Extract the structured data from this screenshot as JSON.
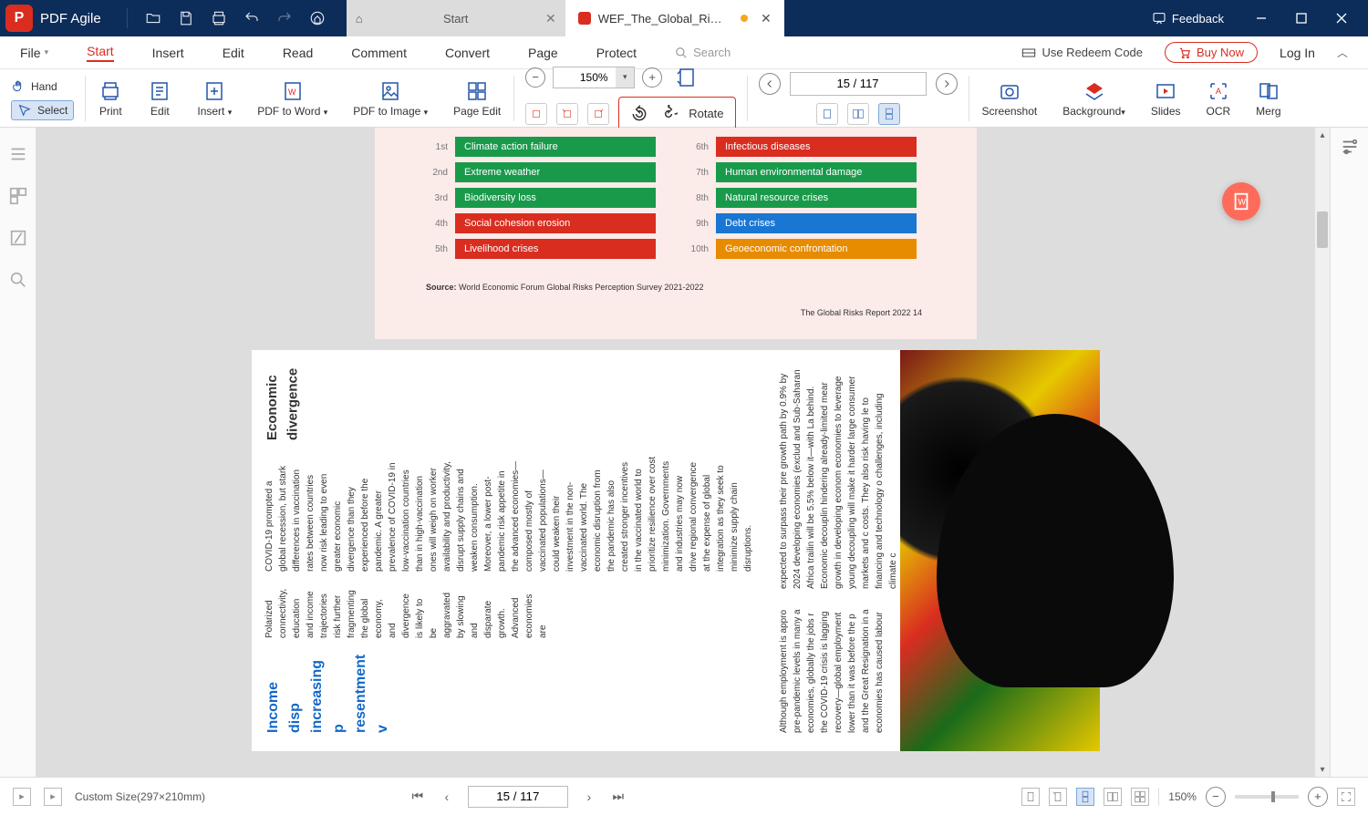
{
  "app": {
    "name": "PDF Agile"
  },
  "tabs": {
    "start": "Start",
    "doc": "WEF_The_Global_Risks_Repo..."
  },
  "titlebar_right": {
    "feedback": "Feedback"
  },
  "menu": {
    "file": "File",
    "start": "Start",
    "insert": "Insert",
    "edit": "Edit",
    "read": "Read",
    "comment": "Comment",
    "convert": "Convert",
    "page": "Page",
    "protect": "Protect",
    "search_ph": "Search",
    "redeem": "Use Redeem Code",
    "buy": "Buy Now",
    "login": "Log In"
  },
  "ribbon": {
    "hand": "Hand",
    "select": "Select",
    "print": "Print",
    "editbtn": "Edit",
    "insertbtn": "Insert",
    "pdf2word": "PDF to Word",
    "pdf2img": "PDF to Image",
    "pageedit": "Page Edit",
    "zoom": "150%",
    "pagefield": "15 / 117",
    "rotate": "Rotate",
    "screenshot": "Screenshot",
    "background": "Background",
    "slides": "Slides",
    "ocr": "OCR",
    "merge": "Merg"
  },
  "doc": {
    "risks_left": [
      {
        "rank": "1st",
        "label": "Climate action failure",
        "cls": "green"
      },
      {
        "rank": "2nd",
        "label": "Extreme weather",
        "cls": "green"
      },
      {
        "rank": "3rd",
        "label": "Biodiversity loss",
        "cls": "green"
      },
      {
        "rank": "4th",
        "label": "Social cohesion erosion",
        "cls": "red"
      },
      {
        "rank": "5th",
        "label": "Livelihood crises",
        "cls": "red"
      }
    ],
    "risks_right": [
      {
        "rank": "6th",
        "label": "Infectious diseases",
        "cls": "red"
      },
      {
        "rank": "7th",
        "label": "Human environmental damage",
        "cls": "green"
      },
      {
        "rank": "8th",
        "label": "Natural resource crises",
        "cls": "green"
      },
      {
        "rank": "9th",
        "label": "Debt crises",
        "cls": "blue"
      },
      {
        "rank": "10th",
        "label": "Geoeconomic confrontation",
        "cls": "orange"
      }
    ],
    "source_label": "Source:",
    "source_text": " World Economic Forum Global Risks Perception Survey 2021-2022",
    "footer": "The Global Risks Report 2022    14",
    "p2_title": "Economic divergence",
    "p2_para1": "COVID-19 prompted a global recession, but stark differences in vaccination rates between countries now risk leading to even greater economic divergence than they experienced before the pandemic. A greater prevalence of COVID-19 in low-vaccination countries than in high-vaccination ones will weigh on worker availability and productivity, disrupt supply chains and weaken consumption. Moreover, a lower post-pandemic risk appetite in the advanced economies—composed mostly of vaccinated populations—could weaken their investment in the non-vaccinated world. The economic disruption from the pandemic has also created stronger incentives in the vaccinated world to prioritize resilience over cost minimization. Governments and industries may now drive regional convergence at the expense of global integration as they seek to minimize supply chain disruptions.",
    "p2_para2": "Polarized connectivity, education and income trajectories risk further fragmenting the global economy, and divergence is likely to be aggravated by slowing and disparate growth. Advanced economies are",
    "p2_para3": "expected to surpass their pre growth path by 0.9% by 2024 developing economies (exclud and Sub-Saharan Africa trailin will be 5.5% below it—with La behind. Economic decouplin hindering already-limited mear growth in developing econom economies to leverage young decoupling will make it harder large consumer markets and c costs. They also risk having le to financing and technology o challenges, including climate c",
    "p2_para4": "Although employment is appro pre-pandemic levels in many a economies, globally the jobs r the COVID-19 crisis is lagging recovery—global employment lower than it was before the p and the Great Resignation in a economies has caused labour",
    "p2_highlight": "Income disp\nincreasing p\nresentment v"
  },
  "status": {
    "size": "Custom Size(297×210mm)",
    "page": "15 / 117",
    "zoom": "150%"
  }
}
